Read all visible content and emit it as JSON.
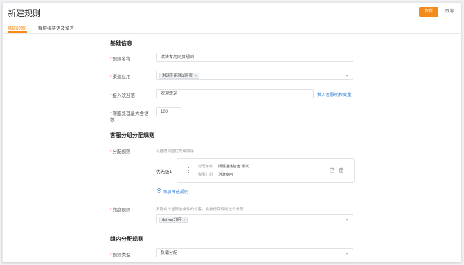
{
  "header": {
    "title": "新建规则",
    "save_label": "保存",
    "cancel_label": "取消"
  },
  "tabs": [
    {
      "label": "基础设置",
      "active": true
    },
    {
      "label": "客服接待语及留言",
      "active": false
    }
  ],
  "basic": {
    "title": "基础信息",
    "rule_name": {
      "label": "规则名称",
      "value": "洪涛专用网页规则"
    },
    "channel": {
      "label": "渠道应用",
      "tag": "洪涛专用测试网页"
    },
    "welcome": {
      "label": "接入欢迎语",
      "value": "欢迎欢迎",
      "link": "插入客服昵称变量"
    },
    "max_sessions": {
      "label_line1": "客服处理最大会话",
      "label_line2": "数",
      "value": "100"
    }
  },
  "group": {
    "title": "客服分组分配规则",
    "assign": {
      "label": "分配规则",
      "hint": "可拖拽调整优先级顺序",
      "priority_label": "优先级1",
      "condition_label": "分配条件",
      "condition_value": "问题描述包含\"测试\"",
      "group_label": "客服分组",
      "group_value": "洪涛专用",
      "add_link": "添加筛选规则"
    },
    "fallback": {
      "label": "兜底规则",
      "hint": "不符合上述筛选条件的访客，会被兜底规则进行分配。",
      "tag": "daiyun分组"
    }
  },
  "inner": {
    "title": "组内分配规则",
    "rule_type": {
      "label": "规则类型",
      "value": "负载分配"
    }
  },
  "colors": {
    "accent": "#f38b1a",
    "link": "#2e7bd6",
    "required": "#e54b4b"
  },
  "icons": [
    "chevron-down-icon",
    "close-icon",
    "drag-handle-icon",
    "edit-icon",
    "trash-icon",
    "plus-circle-icon"
  ]
}
